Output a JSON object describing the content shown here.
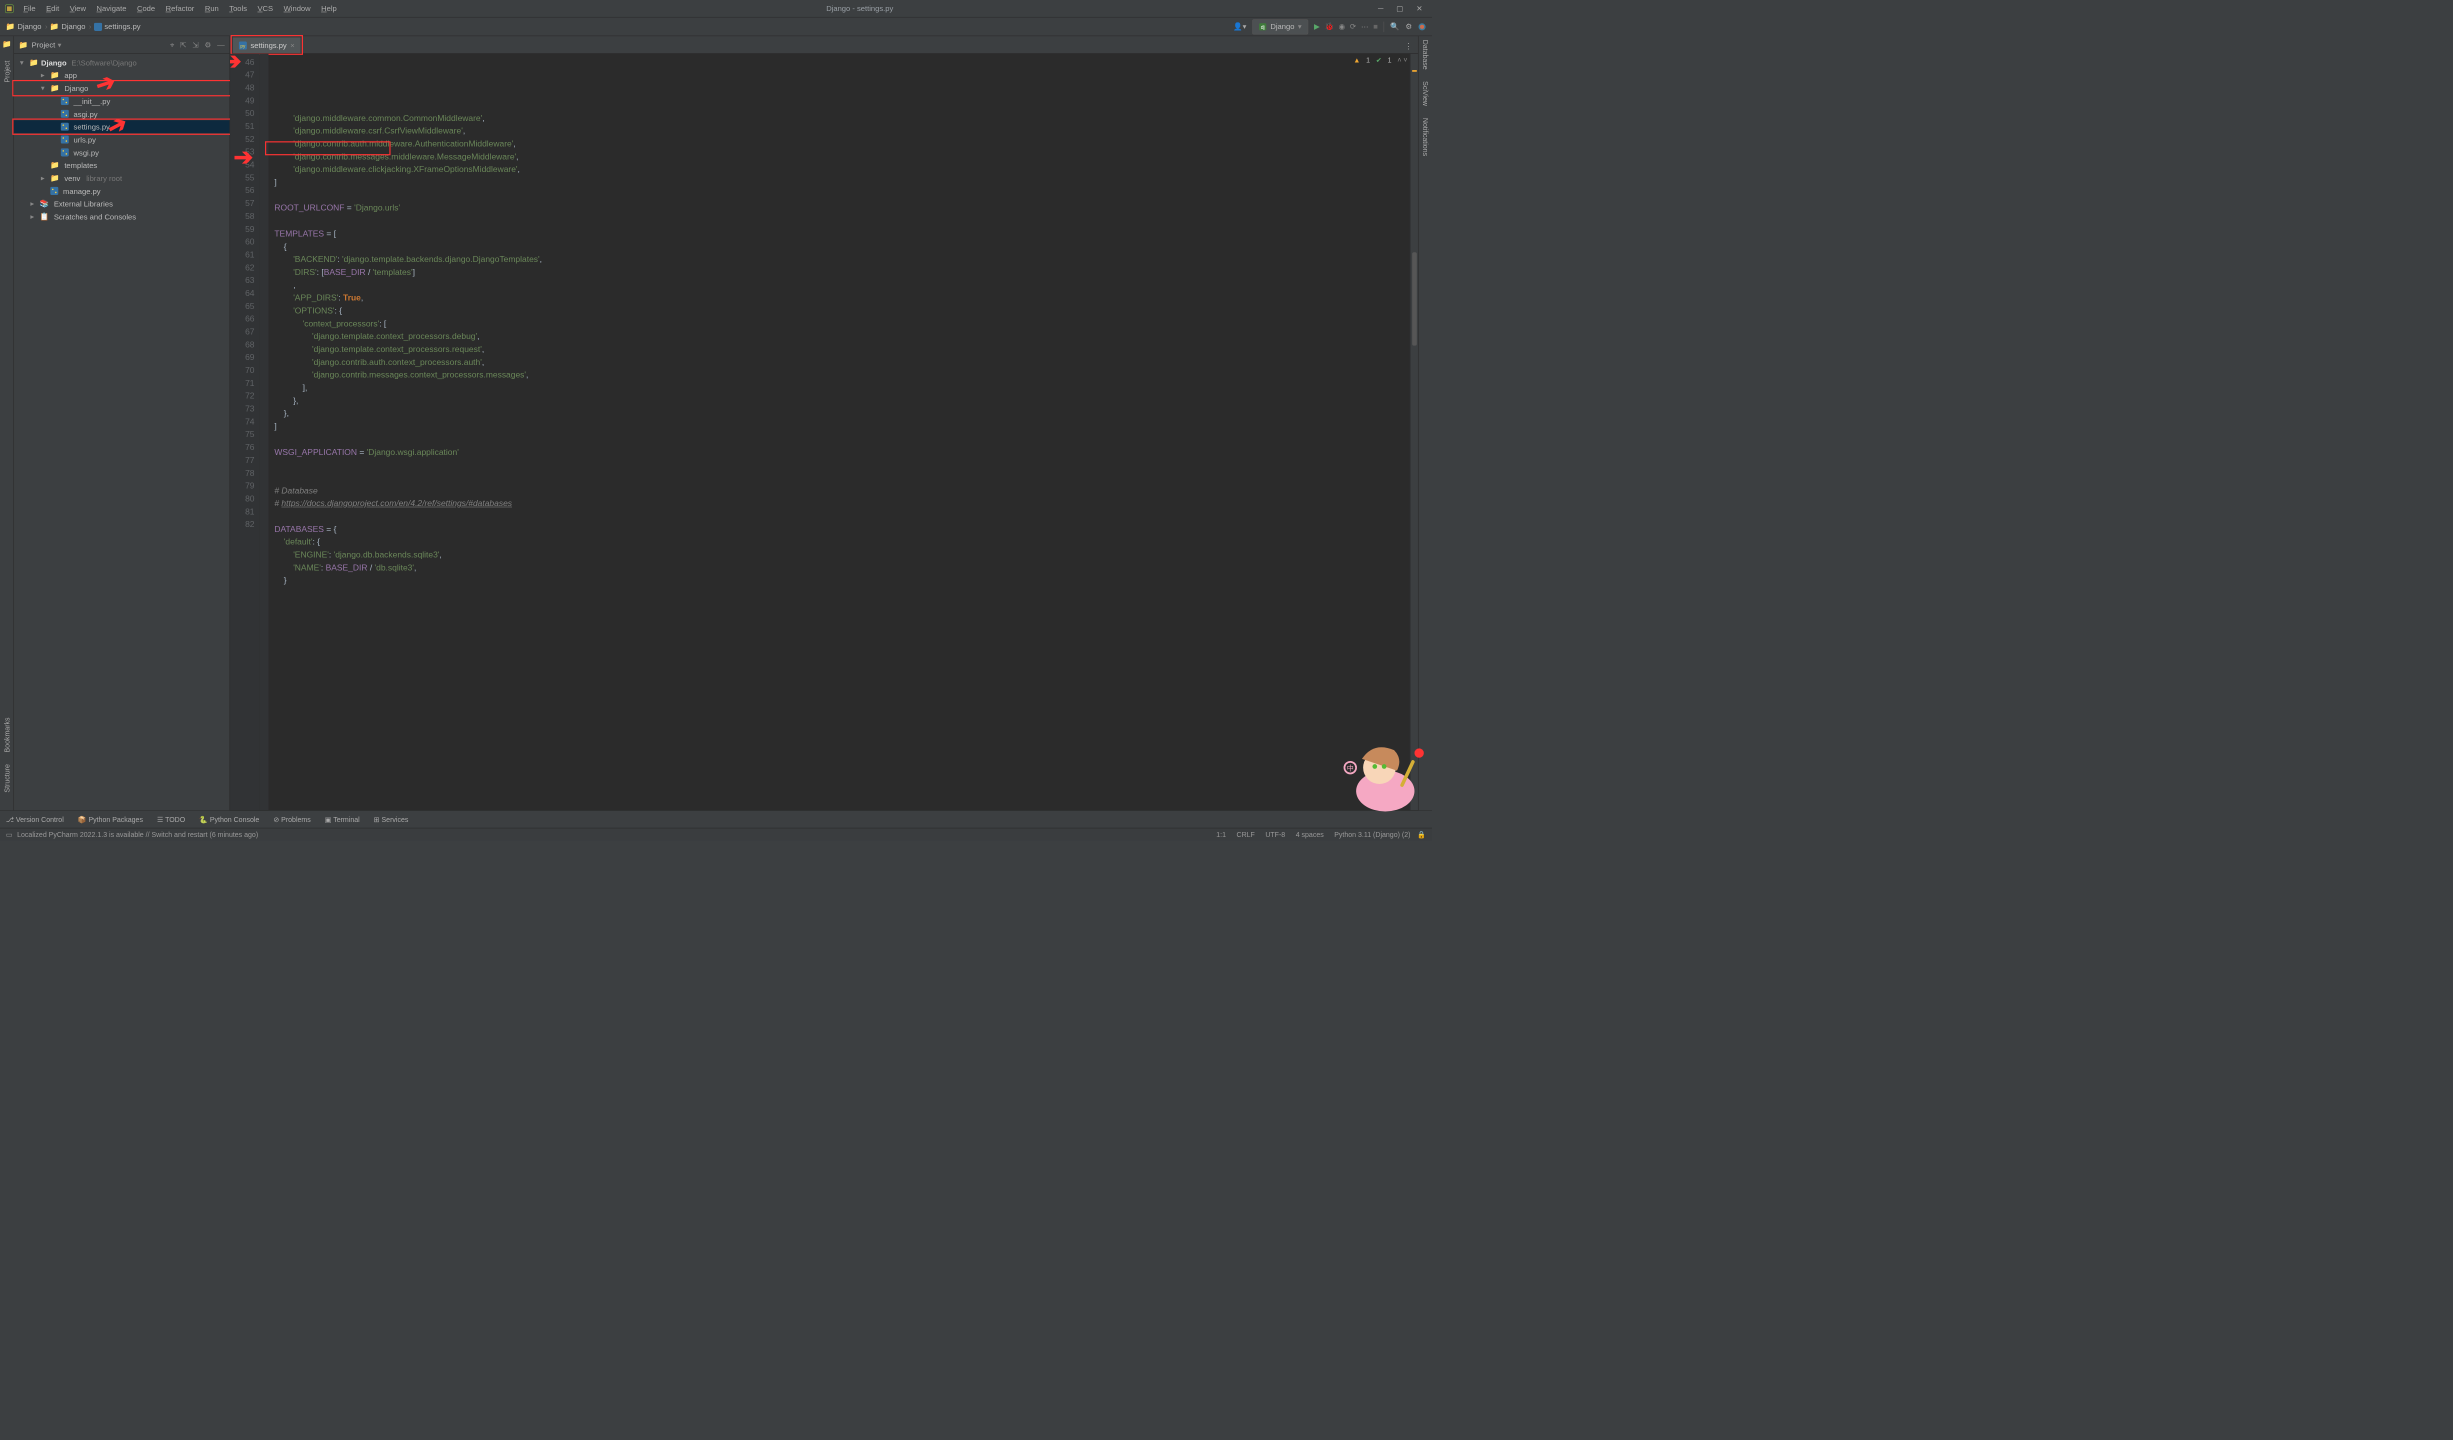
{
  "title": "Django - settings.py",
  "menu": [
    "File",
    "Edit",
    "View",
    "Navigate",
    "Code",
    "Refactor",
    "Run",
    "Tools",
    "VCS",
    "Window",
    "Help"
  ],
  "breadcrumbs": [
    "Django",
    "Django",
    "settings.py"
  ],
  "run_config": "Django",
  "project_panel_title": "Project",
  "tree": {
    "root": {
      "name": "Django",
      "path": "E:\\Software\\Django"
    },
    "nodes": [
      {
        "depth": 1,
        "arrow": "right",
        "type": "dir",
        "label": "app"
      },
      {
        "depth": 1,
        "arrow": "down",
        "type": "dir",
        "label": "Django",
        "box": true
      },
      {
        "depth": 2,
        "type": "py",
        "label": "__init__.py"
      },
      {
        "depth": 2,
        "type": "py",
        "label": "asgi.py"
      },
      {
        "depth": 2,
        "type": "py",
        "label": "settings.py",
        "selected": true,
        "box": true
      },
      {
        "depth": 2,
        "type": "py",
        "label": "urls.py"
      },
      {
        "depth": 2,
        "type": "py",
        "label": "wsgi.py"
      },
      {
        "depth": 1,
        "arrow": "",
        "type": "dir",
        "label": "templates"
      },
      {
        "depth": 1,
        "arrow": "right",
        "type": "dir",
        "label": "venv",
        "trail": "library root"
      },
      {
        "depth": 1,
        "type": "py",
        "label": "manage.py"
      },
      {
        "depth": 0,
        "arrow": "right",
        "type": "lib",
        "label": "External Libraries"
      },
      {
        "depth": 0,
        "arrow": "right",
        "type": "scr",
        "label": "Scratches and Consoles"
      }
    ]
  },
  "tab": {
    "label": "settings.py"
  },
  "code_start_line": 46,
  "code_lines": [
    {
      "n": 46,
      "html": "        <span class='str'>'django.middleware.common.CommonMiddleware'</span><span class='op'>,</span>"
    },
    {
      "n": 47,
      "html": "        <span class='str'>'django.middleware.csrf.CsrfViewMiddleware'</span><span class='op'>,</span>"
    },
    {
      "n": 48,
      "html": "        <span class='str'>'django.contrib.auth.middleware.AuthenticationMiddleware'</span><span class='op'>,</span>"
    },
    {
      "n": 49,
      "html": "        <span class='str'>'django.contrib.messages.middleware.MessageMiddleware'</span><span class='op'>,</span>"
    },
    {
      "n": 50,
      "html": "        <span class='str'>'django.middleware.clickjacking.XFrameOptionsMiddleware'</span><span class='op'>,</span>"
    },
    {
      "n": 51,
      "html": "<span class='op'>]</span>"
    },
    {
      "n": 52,
      "html": ""
    },
    {
      "n": 53,
      "html": "<span class='var'>ROOT_URLCONF</span> <span class='op'>=</span> <span class='str'>'Django.urls'</span>"
    },
    {
      "n": 54,
      "html": ""
    },
    {
      "n": 55,
      "html": "<span class='var'>TEMPLATES</span> <span class='op'>= [</span>"
    },
    {
      "n": 56,
      "html": "    <span class='op'>{</span>"
    },
    {
      "n": 57,
      "html": "        <span class='str'>'BACKEND'</span><span class='op'>:</span> <span class='str'>'django.template.backends.django.DjangoTemplates'</span><span class='op'>,</span>"
    },
    {
      "n": 58,
      "html": "        <span class='str'>'DIRS'</span><span class='op'>: [</span><span class='var'>BASE_DIR</span> <span class='op'>/</span> <span class='str'>'templates'</span><span class='op'>]</span>"
    },
    {
      "n": 59,
      "html": "        <span class='op'>,</span>"
    },
    {
      "n": 60,
      "html": "        <span class='str'>'APP_DIRS'</span><span class='op'>:</span> <span class='boo'>True</span><span class='op'>,</span>"
    },
    {
      "n": 61,
      "html": "        <span class='str'>'OPTIONS'</span><span class='op'>: {</span>"
    },
    {
      "n": 62,
      "html": "            <span class='str'>'context_processors'</span><span class='op'>: [</span>"
    },
    {
      "n": 63,
      "html": "                <span class='str'>'django.template.context_processors.debug'</span><span class='op'>,</span>"
    },
    {
      "n": 64,
      "html": "                <span class='str'>'django.template.context_processors.request'</span><span class='op'>,</span>"
    },
    {
      "n": 65,
      "html": "                <span class='str'>'django.contrib.auth.context_processors.auth'</span><span class='op'>,</span>"
    },
    {
      "n": 66,
      "html": "                <span class='str'>'django.contrib.messages.context_processors.messages'</span><span class='op'>,</span>"
    },
    {
      "n": 67,
      "html": "            <span class='op'>],</span>"
    },
    {
      "n": 68,
      "html": "        <span class='op'>},</span>"
    },
    {
      "n": 69,
      "html": "    <span class='op'>},</span>"
    },
    {
      "n": 70,
      "html": "<span class='op'>]</span>"
    },
    {
      "n": 71,
      "html": ""
    },
    {
      "n": 72,
      "html": "<span class='var'>WSGI_APPLICATION</span> <span class='op'>=</span> <span class='str'>'Django.wsgi.application'</span>"
    },
    {
      "n": 73,
      "html": ""
    },
    {
      "n": 74,
      "html": ""
    },
    {
      "n": 75,
      "html": "<span class='com'># Database</span>"
    },
    {
      "n": 76,
      "html": "<span class='com'># <span class='url-u'>https://docs.djangoproject.com/en/4.2/ref/settings/#databases</span></span>"
    },
    {
      "n": 77,
      "html": ""
    },
    {
      "n": 78,
      "html": "<span class='var'>DATABASES</span> <span class='op'>= {</span>"
    },
    {
      "n": 79,
      "html": "    <span class='str'>'default'</span><span class='op'>: {</span>"
    },
    {
      "n": 80,
      "html": "        <span class='str'>'ENGINE'</span><span class='op'>:</span> <span class='str'>'django.db.backends.sqlite3'</span><span class='op'>,</span>"
    },
    {
      "n": 81,
      "html": "        <span class='str'>'NAME'</span><span class='op'>:</span> <span class='var'>BASE_DIR</span> <span class='op'>/</span> <span class='str'>'db.sqlite3'</span><span class='op'>,</span>"
    },
    {
      "n": 82,
      "html": "    <span class='op'>}</span>"
    }
  ],
  "status_inspection": {
    "warn": "1",
    "ok": "1"
  },
  "left_stripe": [
    "Project",
    "Bookmarks",
    "Structure"
  ],
  "right_stripe": [
    "Database",
    "SciView",
    "Notifications"
  ],
  "bottom_tools": [
    "Version Control",
    "Python Packages",
    "TODO",
    "Python Console",
    "Problems",
    "Terminal",
    "Services"
  ],
  "status_msg": "Localized PyCharm 2022.1.3 is available // Switch and restart (6 minutes ago)",
  "status_right": [
    "1:1",
    "CRLF",
    "UTF-8",
    "4 spaces",
    "Python 3.11 (Django) (2)"
  ]
}
